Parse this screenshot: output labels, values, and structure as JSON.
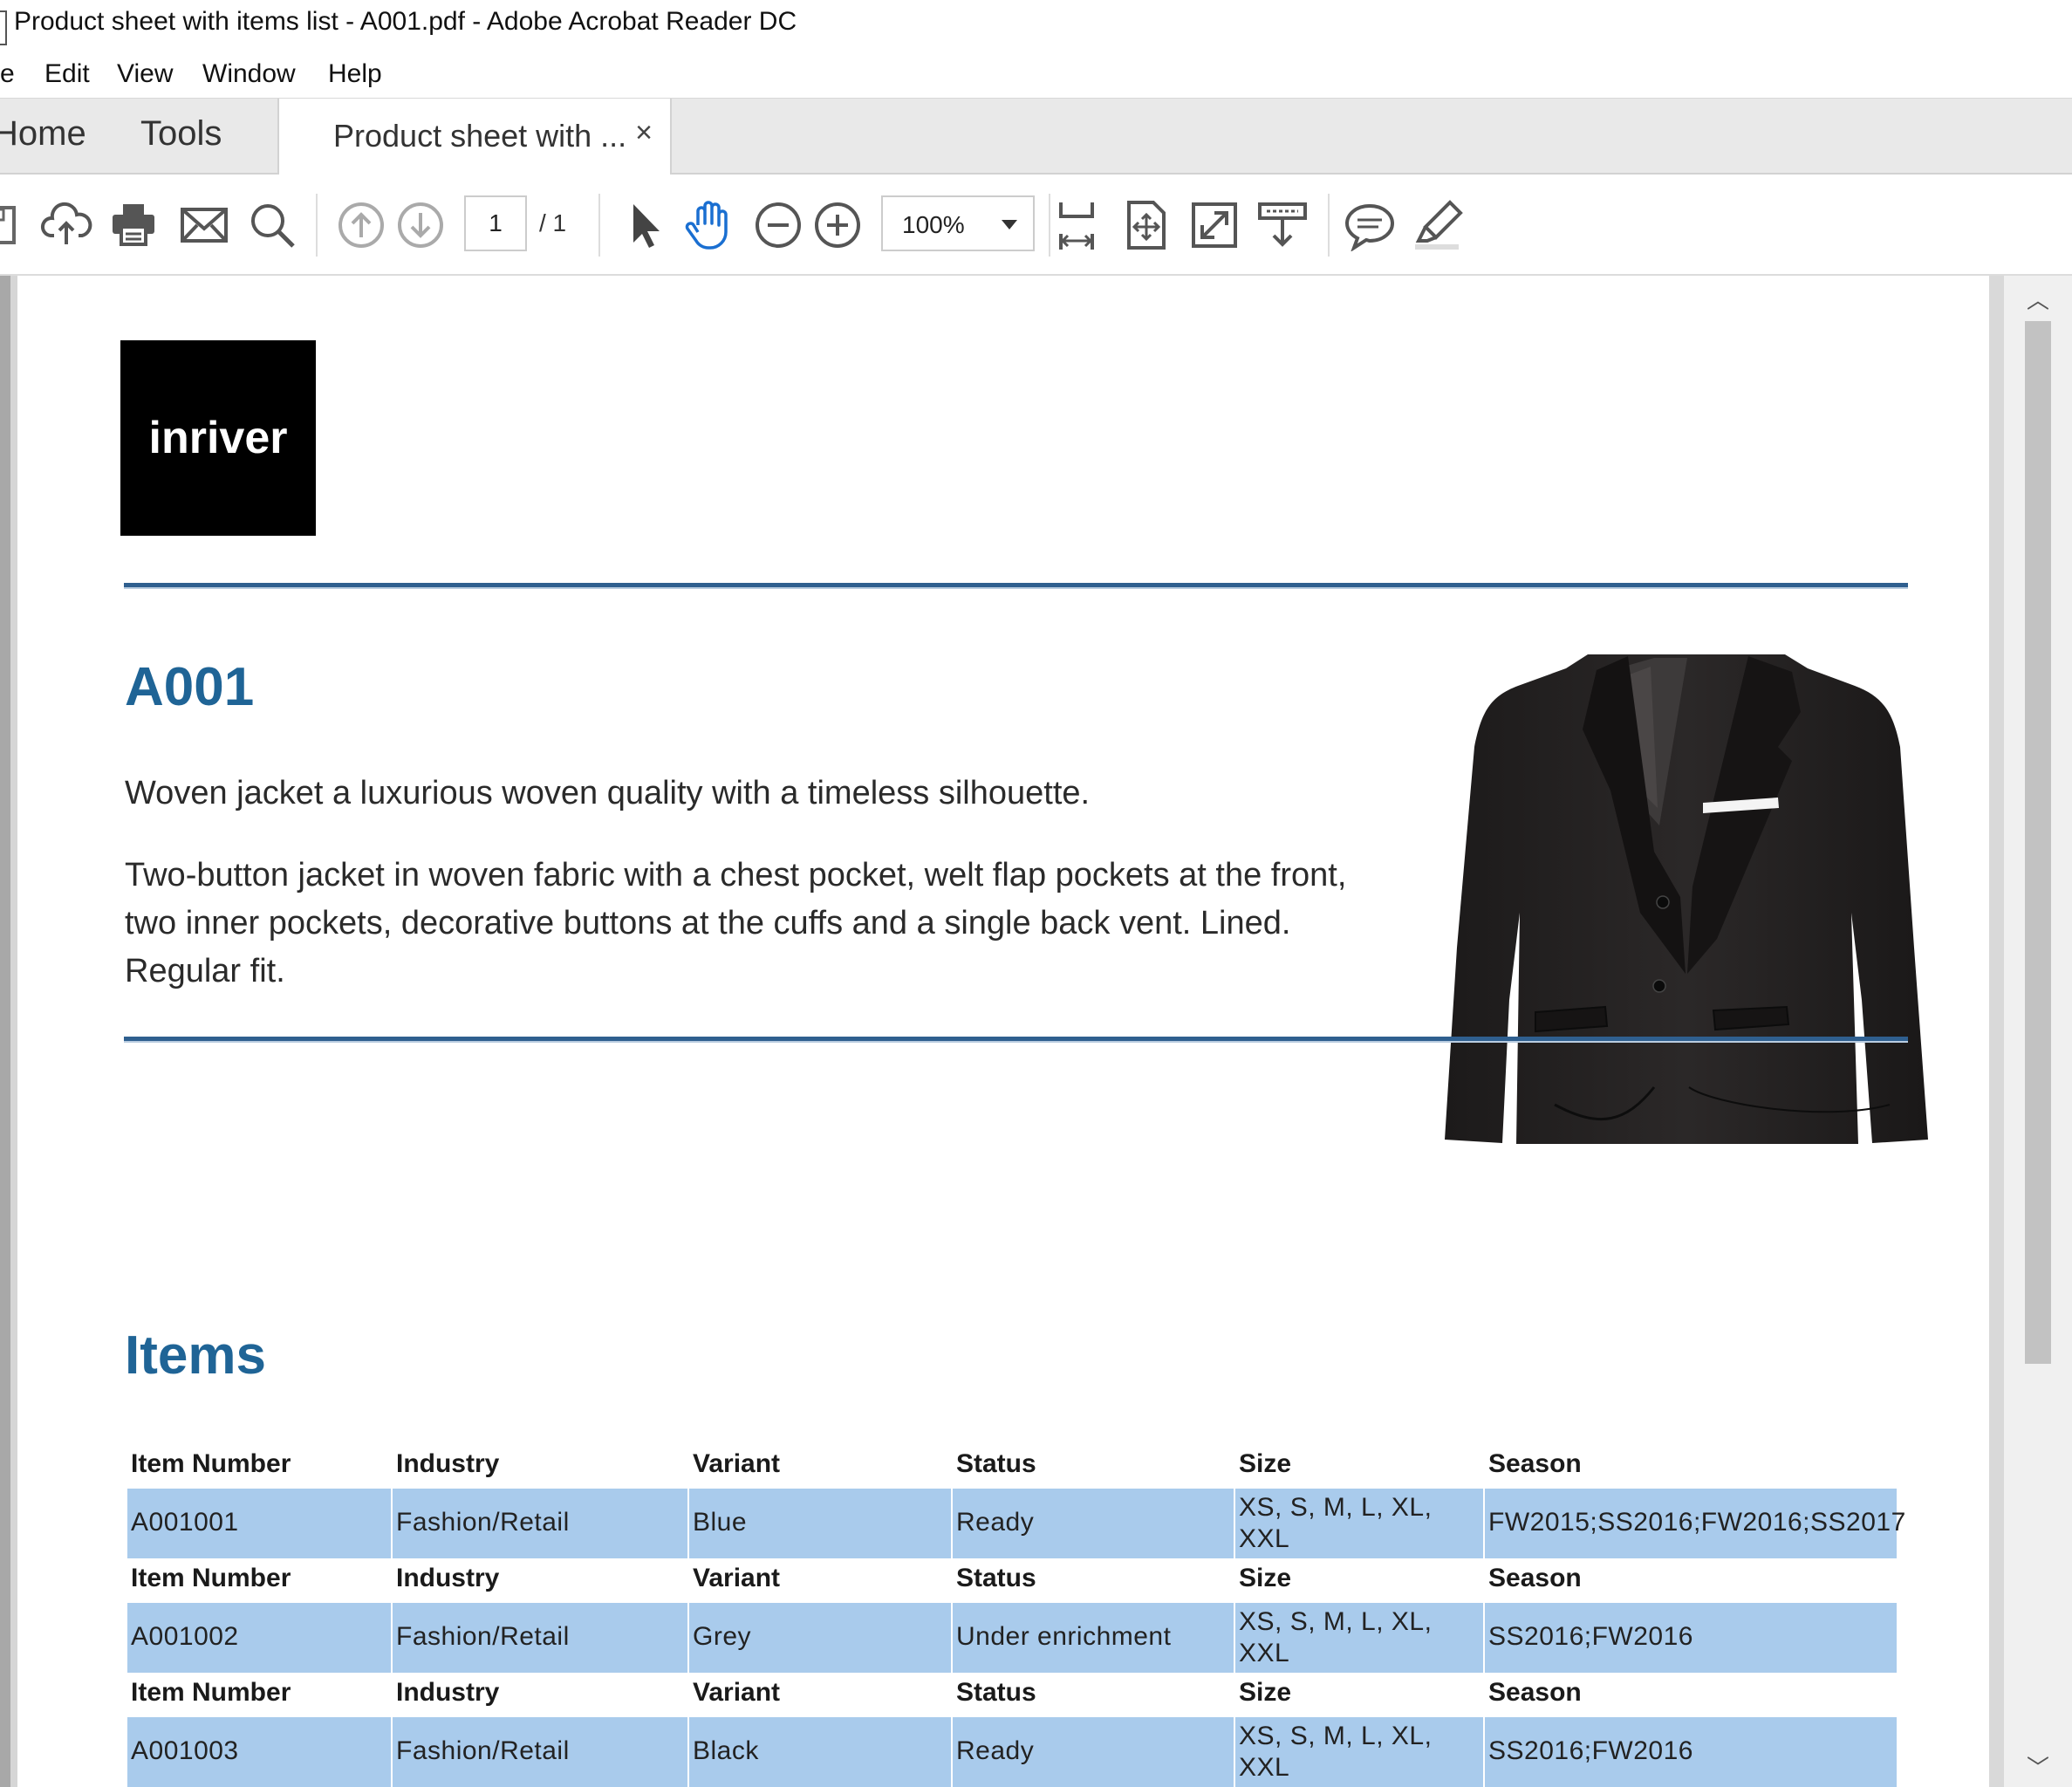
{
  "window": {
    "title": "Product sheet with items list - A001.pdf - Adobe Acrobat Reader DC"
  },
  "menu": {
    "items": [
      "e",
      "Edit",
      "View",
      "Window",
      "Help"
    ]
  },
  "tabs": {
    "home": "Home",
    "tools": "Tools",
    "document": "Product sheet with ...",
    "close": "×"
  },
  "toolbar": {
    "icons": [
      "save-icon",
      "upload-icon",
      "print-icon",
      "mail-icon",
      "search-icon",
      "prev-page-icon",
      "next-page-icon",
      "select-arrow-icon",
      "hand-tool-icon",
      "zoom-out-icon",
      "zoom-in-icon",
      "fit-width-icon",
      "fit-page-icon",
      "full-screen-icon",
      "read-mode-icon",
      "comment-icon",
      "highlight-icon"
    ],
    "page_current": "1",
    "page_total": "/ 1",
    "zoom": "100%"
  },
  "document": {
    "logo_text": "inriver",
    "product_code": "A001",
    "short_description": "Woven jacket a luxurious woven quality with a timeless silhouette.",
    "long_description": "Two-button jacket in woven fabric with a chest pocket, welt flap pockets at the front, two inner pockets, decorative buttons at the cuffs and a single back vent. Lined. Regular fit.",
    "items_heading": "Items",
    "table_headers": [
      "Item Number",
      "Industry",
      "Variant",
      "Status",
      "Size",
      "Season"
    ],
    "items": [
      {
        "item_number": "A001001",
        "industry": "Fashion/Retail",
        "variant": "Blue",
        "status": "Ready",
        "size": "XS, S, M, L, XL, XXL",
        "season": "FW2015;SS2016;FW2016;SS2017"
      },
      {
        "item_number": "A001002",
        "industry": "Fashion/Retail",
        "variant": "Grey",
        "status": "Under enrichment",
        "size": "XS, S, M, L, XL, XXL",
        "season": "SS2016;FW2016"
      },
      {
        "item_number": "A001003",
        "industry": "Fashion/Retail",
        "variant": "Black",
        "status": "Ready",
        "size": "XS, S, M, L, XL, XXL",
        "season": "SS2016;FW2016"
      }
    ]
  },
  "colors": {
    "heading_blue": "#1f6496",
    "rule_blue": "#2f5f8f",
    "row_blue": "#a9cbec",
    "hand_tool_blue": "#1a6fd1"
  }
}
